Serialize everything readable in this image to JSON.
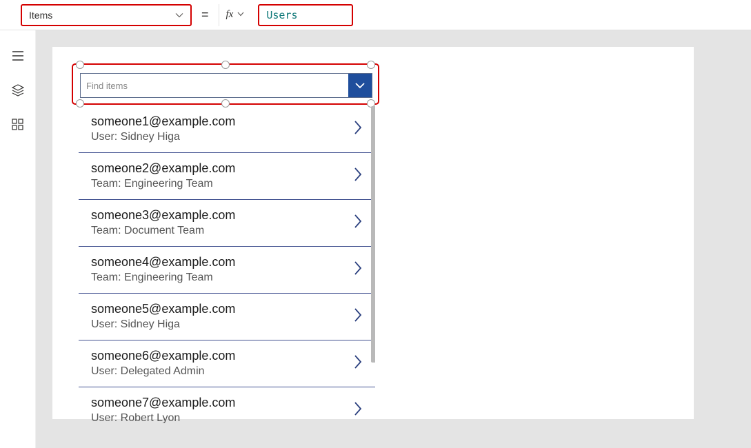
{
  "topbar": {
    "property_label": "Items",
    "equals": "=",
    "fx_label": "fx",
    "formula_value": "Users"
  },
  "combobox": {
    "placeholder": "Find items"
  },
  "gallery": {
    "items": [
      {
        "title": "someone1@example.com",
        "subtitle": "User: Sidney Higa"
      },
      {
        "title": "someone2@example.com",
        "subtitle": "Team: Engineering Team"
      },
      {
        "title": "someone3@example.com",
        "subtitle": "Team: Document Team"
      },
      {
        "title": "someone4@example.com",
        "subtitle": "Team: Engineering Team"
      },
      {
        "title": "someone5@example.com",
        "subtitle": "User: Sidney Higa"
      },
      {
        "title": "someone6@example.com",
        "subtitle": "User: Delegated Admin"
      },
      {
        "title": "someone7@example.com",
        "subtitle": "User: Robert Lyon"
      }
    ]
  }
}
